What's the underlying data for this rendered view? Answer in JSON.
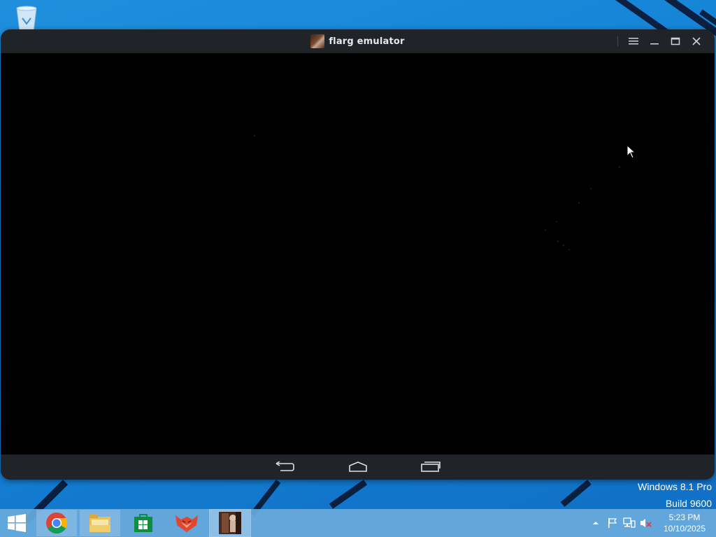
{
  "desktop": {
    "recycle_bin_icon": "recycle-bin-icon",
    "watermark": {
      "line1": "Windows 8.1 Pro",
      "line2": "Build 9600"
    }
  },
  "window": {
    "title": "flarg emulator",
    "app_icon": "flarg-app-icon",
    "controls": {
      "menu_icon": "hamburger-menu-icon",
      "minimize_icon": "minimize-icon",
      "maximize_icon": "maximize-icon",
      "close_icon": "close-icon"
    },
    "navbar": {
      "back_icon": "back-icon",
      "home_icon": "home-icon",
      "recents_icon": "recent-apps-icon"
    }
  },
  "taskbar": {
    "start_icon": "windows-start-icon",
    "apps": [
      {
        "name": "Google Chrome",
        "icon": "chrome-icon"
      },
      {
        "name": "File Explorer",
        "icon": "folder-icon"
      },
      {
        "name": "Store",
        "icon": "store-icon"
      },
      {
        "name": "Fox app",
        "icon": "fox-icon"
      },
      {
        "name": "flarg emulator",
        "icon": "flarg-app-icon"
      }
    ],
    "tray": {
      "show_hidden_icon": "chevron-up-icon",
      "action_center_icon": "flag-icon",
      "network_icon": "network-icon",
      "volume_icon": "volume-muted-icon"
    },
    "clock": {
      "time": "5:23 PM",
      "date": "10/10/2025"
    }
  },
  "colors": {
    "desktop_blue": "#1583d6",
    "window_chrome": "#202328",
    "screen": "#000000",
    "taskbar": "#69aadc"
  }
}
